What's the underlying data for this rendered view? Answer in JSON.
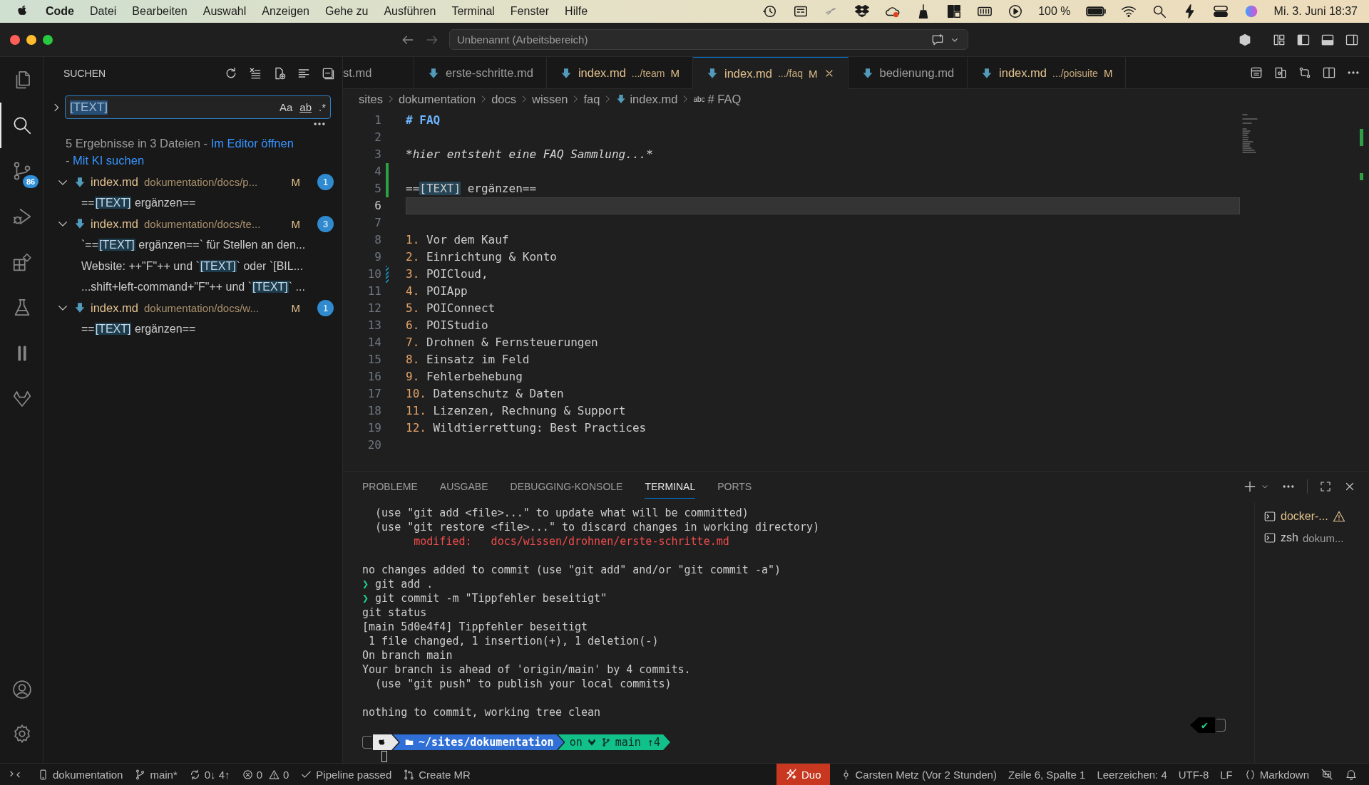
{
  "menu_bar": {
    "app": "Code",
    "items": [
      "Datei",
      "Bearbeiten",
      "Auswahl",
      "Anzeigen",
      "Gehe zu",
      "Ausführen",
      "Terminal",
      "Fenster",
      "Hilfe"
    ],
    "battery": "100 %",
    "clock": "Mi. 3. Juni 18:37"
  },
  "title_bar": {
    "search": "Unbenannt (Arbeitsbereich)"
  },
  "activity_bar": {
    "top": [
      {
        "kind": "explorer",
        "selected": false
      },
      {
        "kind": "search",
        "selected": true
      },
      {
        "kind": "source-control",
        "selected": false,
        "badge": "86"
      },
      {
        "kind": "run-debug",
        "selected": false
      },
      {
        "kind": "extensions",
        "selected": false
      },
      {
        "kind": "testing",
        "selected": false
      },
      {
        "kind": "pause",
        "selected": false
      },
      {
        "kind": "fox",
        "selected": false
      }
    ],
    "bottom": [
      {
        "kind": "account"
      },
      {
        "kind": "settings"
      }
    ]
  },
  "search_view": {
    "title": "SUCHEN",
    "query": "[TEXT]",
    "query_selected": true,
    "options": [
      "Aa",
      "ab",
      ".*"
    ],
    "summary": "5 Ergebnisse in 3 Dateien - ",
    "open_in_editor": "Im Editor öffnen",
    "separator": "- ",
    "ai_search": "Mit KI suchen",
    "files": [
      {
        "name": "index.md",
        "path": "dokumentation/docs/p...",
        "status": "M",
        "count": "1",
        "expanded": true,
        "matches": [
          {
            "before": "==",
            "match": "[TEXT]",
            "after": " ergänzen=="
          }
        ]
      },
      {
        "name": "index.md",
        "path": "dokumentation/docs/te...",
        "status": "M",
        "count": "3",
        "expanded": true,
        "matches": [
          {
            "before": "`==",
            "match": "[TEXT]",
            "after": " ergänzen==` für Stellen an den..."
          },
          {
            "before": "Website: ++\"F\"++ und `",
            "match": "[TEXT]",
            "after": "` oder `[BIL..."
          },
          {
            "before": "...shift+left-command+\"F\"++ und `",
            "match": "[TEXT]",
            "after": "` ..."
          }
        ]
      },
      {
        "name": "index.md",
        "path": "dokumentation/docs/w...",
        "status": "M",
        "count": "1",
        "expanded": true,
        "matches": [
          {
            "before": "==",
            "match": "[TEXT]",
            "after": " ergänzen=="
          }
        ]
      }
    ]
  },
  "editor": {
    "tabs": [
      {
        "kind": "cut",
        "label": "st.md",
        "selected": false
      },
      {
        "kind": "file",
        "label": "erste-schritte.md",
        "selected": false
      },
      {
        "kind": "file",
        "label": "index.md",
        "detail": ".../team",
        "status": "M",
        "selected": false
      },
      {
        "kind": "file",
        "label": "index.md",
        "detail": ".../faq",
        "status": "M",
        "selected": true
      },
      {
        "kind": "file",
        "label": "bedienung.md",
        "selected": false
      },
      {
        "kind": "file",
        "label": "index.md",
        "detail": ".../poisuite",
        "status": "M",
        "selected": false
      }
    ],
    "breadcrumb": [
      {
        "kind": "folder",
        "text": "sites"
      },
      {
        "kind": "folder",
        "text": "dokumentation"
      },
      {
        "kind": "folder",
        "text": "docs"
      },
      {
        "kind": "folder",
        "text": "wissen"
      },
      {
        "kind": "folder",
        "text": "faq"
      },
      {
        "kind": "file",
        "text": "index.md"
      },
      {
        "kind": "symbol",
        "text": "# FAQ",
        "symbol": "abc"
      }
    ],
    "lines": [
      {
        "number": "1",
        "current": false,
        "added": false,
        "modified": false,
        "tokens": [
          {
            "kind": "heading",
            "text": "# FAQ"
          }
        ]
      },
      {
        "number": "2",
        "current": false,
        "added": false,
        "modified": false
      },
      {
        "number": "3",
        "current": false,
        "added": false,
        "modified": false,
        "tokens": [
          {
            "kind": "italic",
            "text": "*hier entsteht eine FAQ Sammlung...*"
          }
        ]
      },
      {
        "number": "4",
        "current": false,
        "added": true,
        "modified": false
      },
      {
        "number": "5",
        "current": false,
        "added": true,
        "modified": false,
        "tokens": [
          {
            "kind": "text",
            "text": "=="
          },
          {
            "kind": "match",
            "text": "[TEXT]"
          },
          {
            "kind": "text",
            "text": " ergänzen=="
          }
        ]
      },
      {
        "number": "6",
        "current": true,
        "added": false,
        "modified": false
      },
      {
        "number": "7",
        "current": false,
        "added": false,
        "modified": false
      },
      {
        "number": "8",
        "current": false,
        "added": false,
        "modified": false,
        "tokens": [
          {
            "kind": "list-number",
            "text": "1."
          },
          {
            "kind": "text",
            "text": " Vor dem Kauf"
          }
        ]
      },
      {
        "number": "9",
        "current": false,
        "added": false,
        "modified": false,
        "tokens": [
          {
            "kind": "list-number",
            "text": "2."
          },
          {
            "kind": "text",
            "text": " Einrichtung & Konto"
          }
        ]
      },
      {
        "number": "10",
        "current": false,
        "added": false,
        "modified": true,
        "tokens": [
          {
            "kind": "list-number",
            "text": "3."
          },
          {
            "kind": "text",
            "text": " POICloud,"
          }
        ]
      },
      {
        "number": "11",
        "current": false,
        "added": false,
        "modified": false,
        "tokens": [
          {
            "kind": "list-number",
            "text": "4."
          },
          {
            "kind": "text",
            "text": " POIApp"
          }
        ]
      },
      {
        "number": "12",
        "current": false,
        "added": false,
        "modified": false,
        "tokens": [
          {
            "kind": "list-number",
            "text": "5."
          },
          {
            "kind": "text",
            "text": " POIConnect"
          }
        ]
      },
      {
        "number": "13",
        "current": false,
        "added": false,
        "modified": false,
        "tokens": [
          {
            "kind": "list-number",
            "text": "6."
          },
          {
            "kind": "text",
            "text": " POIStudio"
          }
        ]
      },
      {
        "number": "14",
        "current": false,
        "added": false,
        "modified": false,
        "tokens": [
          {
            "kind": "list-number",
            "text": "7."
          },
          {
            "kind": "text",
            "text": " Drohnen & Fernsteuerungen"
          }
        ]
      },
      {
        "number": "15",
        "current": false,
        "added": false,
        "modified": false,
        "tokens": [
          {
            "kind": "list-number",
            "text": "8."
          },
          {
            "kind": "text",
            "text": " Einsatz im Feld"
          }
        ]
      },
      {
        "number": "16",
        "current": false,
        "added": false,
        "modified": false,
        "tokens": [
          {
            "kind": "list-number",
            "text": "9."
          },
          {
            "kind": "text",
            "text": " Fehlerbehebung"
          }
        ]
      },
      {
        "number": "17",
        "current": false,
        "added": false,
        "modified": false,
        "tokens": [
          {
            "kind": "list-number",
            "text": "10."
          },
          {
            "kind": "text",
            "text": " Datenschutz & Daten"
          }
        ]
      },
      {
        "number": "18",
        "current": false,
        "added": false,
        "modified": false,
        "tokens": [
          {
            "kind": "list-number",
            "text": "11."
          },
          {
            "kind": "text",
            "text": " Lizenzen, Rechnung & Support"
          }
        ]
      },
      {
        "number": "19",
        "current": false,
        "added": false,
        "modified": false,
        "tokens": [
          {
            "kind": "list-number",
            "text": "12."
          },
          {
            "kind": "text",
            "text": " Wildtierrettung: Best Practices"
          }
        ]
      },
      {
        "number": "20",
        "current": false,
        "added": false,
        "modified": false
      }
    ]
  },
  "panel": {
    "tabs": [
      {
        "label": "PROBLEME",
        "selected": false
      },
      {
        "label": "AUSGABE",
        "selected": false
      },
      {
        "label": "DEBUGGING-KONSOLE",
        "selected": false
      },
      {
        "label": "TERMINAL",
        "selected": true
      },
      {
        "label": "PORTS",
        "selected": false
      }
    ],
    "terminal": [
      {
        "kind": "output",
        "text": "  (use \"git add <file>...\" to update what will be committed)"
      },
      {
        "kind": "output",
        "text": "  (use \"git restore <file>...\" to discard changes in working directory)"
      },
      {
        "kind": "modified",
        "text": "        modified:   docs/wissen/drohnen/erste-schritte.md"
      },
      {
        "kind": "blank"
      },
      {
        "kind": "output",
        "text": "no changes added to commit (use \"git add\" and/or \"git commit -a\")"
      },
      {
        "kind": "command",
        "prompt": "❯",
        "text": " git add ."
      },
      {
        "kind": "command",
        "prompt": "❯",
        "text": " git commit -m \"Tippfehler beseitigt\""
      },
      {
        "kind": "output",
        "text": "git status"
      },
      {
        "kind": "output",
        "text": "[main 5d0e4f4] Tippfehler beseitigt"
      },
      {
        "kind": "output",
        "text": " 1 file changed, 1 insertion(+), 1 deletion(-)"
      },
      {
        "kind": "output",
        "text": "On branch main"
      },
      {
        "kind": "output",
        "text": "Your branch is ahead of 'origin/main' by 4 commits."
      },
      {
        "kind": "output",
        "text": "  (use \"git push\" to publish your local commits)"
      },
      {
        "kind": "blank"
      },
      {
        "kind": "output",
        "text": "nothing to commit, working tree clean"
      },
      {
        "kind": "blank"
      }
    ],
    "prompt": {
      "path": "~/sites/dokumentation",
      "on": "on",
      "branch": "main ↑4",
      "status": "✔"
    },
    "terminals": [
      {
        "name": "docker-...",
        "warning": true
      },
      {
        "name": "zsh",
        "detail": "dokum...",
        "warning": false
      }
    ]
  },
  "status_bar": {
    "left": [
      {
        "kind": "remote"
      },
      {
        "kind": "device",
        "text": "dokumentation"
      },
      {
        "kind": "branch",
        "text": "main*"
      },
      {
        "kind": "sync",
        "text": "0↓ 4↑"
      },
      {
        "kind": "problems",
        "errors": "0",
        "warnings": "0"
      },
      {
        "kind": "pipeline",
        "text": "Pipeline passed"
      },
      {
        "kind": "merge-request",
        "text": "Create MR"
      }
    ],
    "duo": "Duo",
    "right": [
      {
        "kind": "blame",
        "text": "Carsten Metz (Vor 2 Stunden)"
      },
      {
        "kind": "plain",
        "text": "Zeile 6, Spalte 1"
      },
      {
        "kind": "plain",
        "text": "Leerzeichen: 4"
      },
      {
        "kind": "plain",
        "text": "UTF-8"
      },
      {
        "kind": "plain",
        "text": "LF"
      },
      {
        "kind": "language",
        "text": "Markdown"
      },
      {
        "kind": "assistant"
      },
      {
        "kind": "bell"
      }
    ]
  }
}
